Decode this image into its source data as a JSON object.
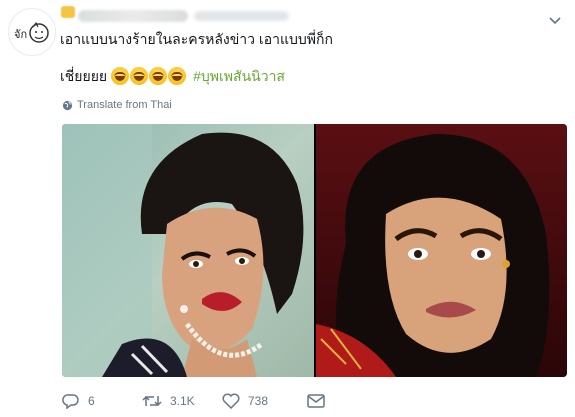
{
  "tweet": {
    "avatar_text": "จัก",
    "text_line1": "เอาแบบนางร้ายในละครหลังข่าว เอาแบบพี่ก็ก",
    "text_line2": "เชี่ยยยย",
    "hashtag": "#บุพเพสันนิวาส",
    "translate_label": "Translate from Thai"
  },
  "actions": {
    "replies": "6",
    "retweets": "3.1K",
    "likes": "738"
  },
  "colors": {
    "hashtag": "#6aa836",
    "muted": "#657786"
  },
  "icons": [
    "chevron-down-icon",
    "globe-icon",
    "reply-icon",
    "retweet-icon",
    "like-icon",
    "dm-icon"
  ]
}
